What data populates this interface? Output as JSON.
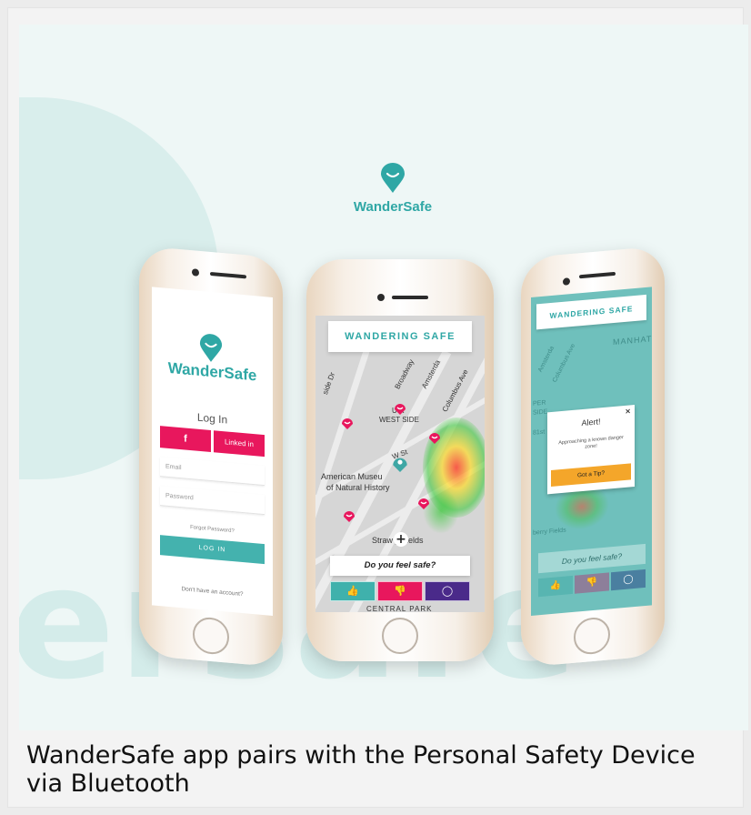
{
  "brand": {
    "name": "WanderSafe",
    "accent": "#2fa7a5"
  },
  "background_word": "ersafe",
  "caption": "WanderSafe app pairs with the Personal Safety Device via Bluetooth",
  "login_screen": {
    "brand": "WanderSafe",
    "title": "Log In",
    "facebook_label": "f",
    "linkedin_label": "Linked in",
    "email_placeholder": "Email",
    "password_placeholder": "Password",
    "forgot_password": "Forgot Password?",
    "login_button": "LOG IN",
    "no_account": "Don't have an account?",
    "colors": {
      "social": "#e8175d",
      "login": "#44b2ae"
    }
  },
  "map_screen": {
    "title": "WANDERING SAFE",
    "labels": {
      "broadway": "Broadway",
      "amsterdam": "Amsterda",
      "columbus": "Columbus Ave",
      "upper": "U    R",
      "west_side": "WEST SIDE",
      "w_st": "W    St",
      "museum_1": "American Museu",
      "museum_2": "of Natural History",
      "strawberry": "Straw    y Fields",
      "central_park": "CENTRAL PARK",
      "side_dr": "side Dr"
    },
    "question": "Do you feel safe?",
    "vote_icons": [
      "thumbs-up-icon",
      "thumbs-down-icon",
      "comment-icon"
    ],
    "vote_colors": [
      "#3fb1ac",
      "#e8175d",
      "#4a2a8a"
    ]
  },
  "alert_screen": {
    "title": "WANDERING SAFE",
    "manhattan": "MANHAT",
    "alert_title": "Alert!",
    "alert_message": "Approaching a known danger zone!",
    "close": "×",
    "tip_button": "Got a Tip?",
    "question": "Do you feel safe?",
    "side_labels": {
      "top": "Amsterda",
      "columbus": "Columbus Ave",
      "berry": "berry Fields",
      "upper": "PER",
      "side": "SIDE",
      "st": "81st"
    }
  }
}
